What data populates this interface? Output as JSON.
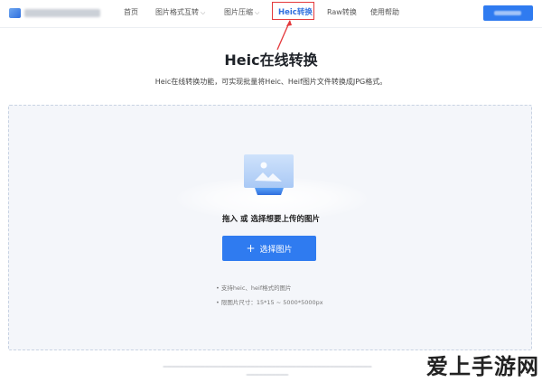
{
  "header": {
    "nav": [
      {
        "label": "首页",
        "dropdown": false
      },
      {
        "label": "图片格式互转",
        "dropdown": true
      },
      {
        "label": "图片压缩",
        "dropdown": true
      },
      {
        "label": "Heic转换",
        "dropdown": false,
        "active": true
      },
      {
        "label": "Raw转换",
        "dropdown": false
      },
      {
        "label": "使用帮助",
        "dropdown": false
      }
    ],
    "accent": "#2f6fde",
    "highlight_color": "#e4393c"
  },
  "page": {
    "title": "Heic在线转换",
    "subtitle": "Heic在线转换功能，可实现批量将Heic、Heif图片文件转换成JPG格式。"
  },
  "upload": {
    "icon": "image-upload-icon",
    "hint": "拖入 或 选择想要上传的图片",
    "button_label": "选择图片",
    "button_icon": "plus-icon",
    "tips": [
      "• 支持heic、heif格式的图片",
      "• 限图片尺寸：15*15 ~ 5000*5000px"
    ]
  },
  "watermark": "爱上手游网"
}
